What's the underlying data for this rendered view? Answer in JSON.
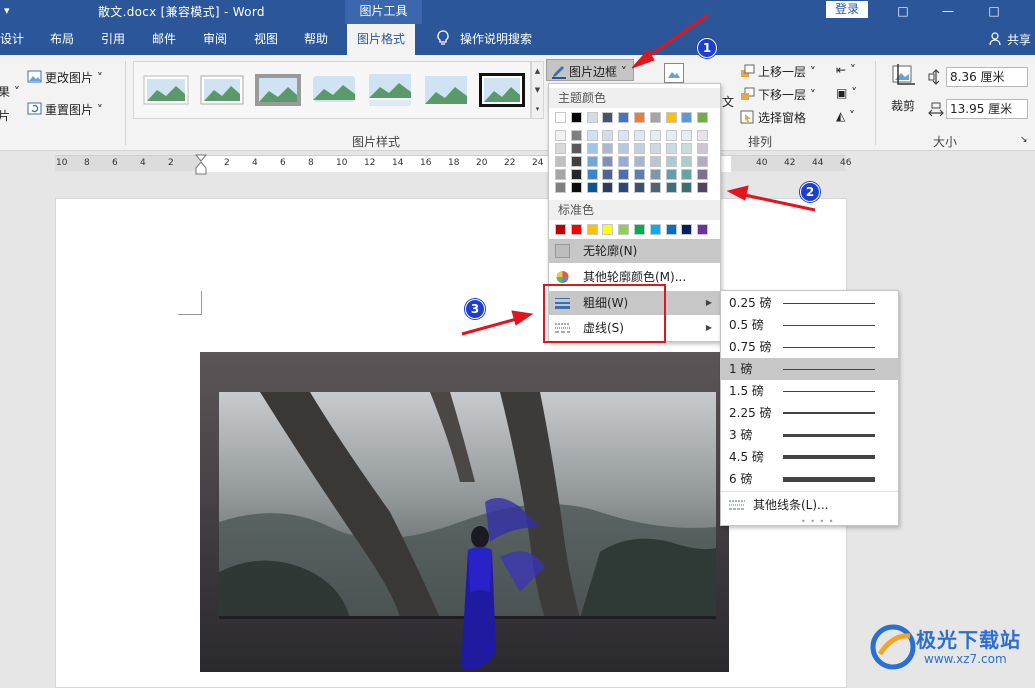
{
  "titlebar": {
    "qat": "▾",
    "doc_title": "散文.docx [兼容模式] - Word",
    "context_tab": "图片工具",
    "login": "登录",
    "win_restore": "□",
    "win_min": "—",
    "win_max": "□"
  },
  "tabs": {
    "design": "设计",
    "layout": "布局",
    "references": "引用",
    "mailings": "邮件",
    "review": "审阅",
    "view": "视图",
    "help": "帮助",
    "picture_format": "图片格式",
    "tell_me": "操作说明搜索",
    "share": "共享"
  },
  "ribbon": {
    "left_partial_1": "果 ˅",
    "left_partial_2": "片",
    "change_picture": "更改图片 ˅",
    "reset_picture": "重置图片 ˅",
    "picture_styles_label": "图片样式",
    "picture_border": "图片边框 ˅",
    "wrap_text_partial": "文",
    "bring_forward": "上移一层 ˅",
    "send_backward": "下移一层 ˅",
    "selection_pane": "选择窗格",
    "arrange_label": "排列",
    "crop": "裁剪",
    "height": "8.36 厘米",
    "width": "13.95 厘米",
    "size_label": "大小"
  },
  "ruler": {
    "ticks": [
      "10",
      "8",
      "6",
      "4",
      "2",
      "",
      "2",
      "4",
      "6",
      "8",
      "10",
      "12",
      "14",
      "16",
      "18",
      "20",
      "22",
      "24",
      "",
      "",
      "",
      "",
      "",
      "",
      "",
      "40",
      "42",
      "44",
      "46"
    ]
  },
  "outline_menu": {
    "theme_colors_label": "主题颜色",
    "standard_colors_label": "标准色",
    "no_outline": "无轮廓(N)",
    "more_colors": "其他轮廓颜色(M)...",
    "weight": "粗细(W)",
    "dashes": "虚线(S)",
    "theme_top": [
      "#ffffff",
      "#000000",
      "#d6dce5",
      "#44546a",
      "#4472c4",
      "#ed7d31",
      "#a5a5a5",
      "#ffc000",
      "#5b9bd5",
      "#70ad47"
    ],
    "theme_cols": [
      [
        "#f2f2f2",
        "#d9d9d9",
        "#bfbfbf",
        "#a6a6a6",
        "#7f7f7f"
      ],
      [
        "#808080",
        "#595959",
        "#404040",
        "#262626",
        "#0d0d0d"
      ],
      [
        "#cfe2f3",
        "#9fc5e8",
        "#6fa8dc",
        "#3d85c6",
        "#0b5394"
      ],
      [
        "#d6dbe8",
        "#aeb7d1",
        "#7f8fb8",
        "#4f6394",
        "#2e3b5c"
      ],
      [
        "#dce3f3",
        "#b8c7e7",
        "#95abdb",
        "#4d6eb5",
        "#2e4677"
      ],
      [
        "#e0e7f1",
        "#c1cfe3",
        "#a2b7d5",
        "#5e7fae",
        "#3a5172"
      ],
      [
        "#e7ecef",
        "#cfd9df",
        "#b7c6cf",
        "#7f98a8",
        "#4f6573"
      ],
      [
        "#e2eef1",
        "#c5dde3",
        "#a8ccd5",
        "#5f9fb0",
        "#39707d"
      ],
      [
        "#e4eeee",
        "#c9dddd",
        "#aecccc",
        "#6aa2a2",
        "#3f6d6d"
      ],
      [
        "#e6e3ea",
        "#cdc7d5",
        "#b4abc0",
        "#7e6f91",
        "#4f4560"
      ]
    ],
    "standard": [
      "#c00000",
      "#ff0000",
      "#ffc000",
      "#ffff00",
      "#92d050",
      "#00b050",
      "#00b0f0",
      "#0070c0",
      "#002060",
      "#7030a0"
    ]
  },
  "weight_menu": {
    "items": [
      {
        "label": "0.25 磅",
        "thickness": 0.25
      },
      {
        "label": "0.5 磅",
        "thickness": 0.5
      },
      {
        "label": "0.75 磅",
        "thickness": 0.75
      },
      {
        "label": "1 磅",
        "thickness": 1
      },
      {
        "label": "1.5 磅",
        "thickness": 1.5
      },
      {
        "label": "2.25 磅",
        "thickness": 2.25
      },
      {
        "label": "3 磅",
        "thickness": 3
      },
      {
        "label": "4.5 磅",
        "thickness": 4.5
      },
      {
        "label": "6 磅",
        "thickness": 6
      }
    ],
    "selected": "1 磅",
    "more_lines": "其他线条(L)..."
  },
  "annotations": {
    "badge1": "1",
    "badge2": "2",
    "badge3": "3",
    "arrow_color": "#e0161e"
  },
  "watermark": {
    "title": "极光下载站",
    "url": "www.xz7.com"
  }
}
